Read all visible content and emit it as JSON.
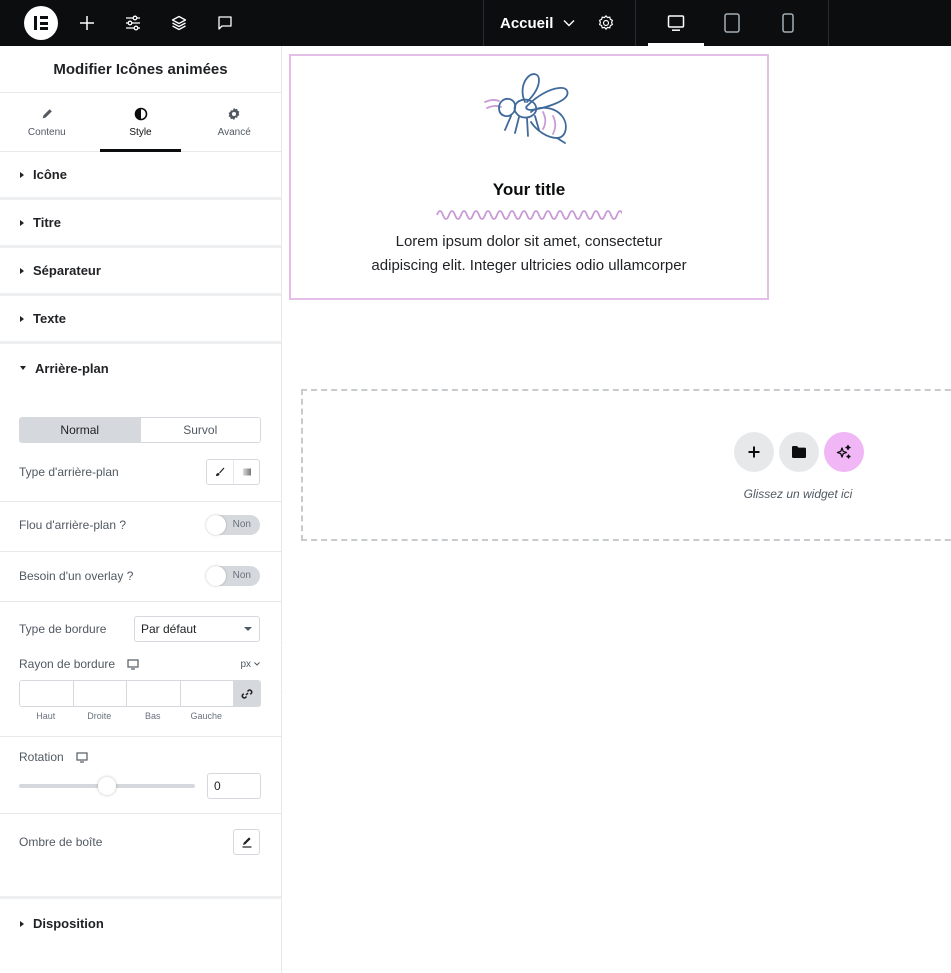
{
  "topbar": {
    "logo": "elementor-logo",
    "buttons": [
      "add-element",
      "site-settings",
      "structure",
      "notes"
    ],
    "page_name": "Accueil",
    "devices": [
      "desktop",
      "tablet",
      "mobile"
    ],
    "active_device": "desktop"
  },
  "panel": {
    "title": "Modifier Icônes animées",
    "tabs": [
      {
        "label": "Contenu",
        "icon": "pencil-icon"
      },
      {
        "label": "Style",
        "icon": "contrast-icon"
      },
      {
        "label": "Avancé",
        "icon": "gear-icon"
      }
    ],
    "active_tab": "Style",
    "sections": [
      {
        "label": "Icône",
        "open": false
      },
      {
        "label": "Titre",
        "open": false
      },
      {
        "label": "Séparateur",
        "open": false
      },
      {
        "label": "Texte",
        "open": false
      },
      {
        "label": "Arrière-plan",
        "open": true
      }
    ],
    "background": {
      "state_tabs": [
        "Normal",
        "Survol"
      ],
      "active_state": "Normal",
      "type_label": "Type d'arrière-plan",
      "blur_label": "Flou d'arrière-plan ?",
      "blur_value": "Non",
      "overlay_label": "Besoin d'un overlay ?",
      "overlay_value": "Non",
      "border_type_label": "Type de bordure",
      "border_type_value": "Par défaut",
      "radius_label": "Rayon de bordure",
      "radius_unit": "px",
      "radius_fields": [
        {
          "label": "Haut",
          "value": ""
        },
        {
          "label": "Droite",
          "value": ""
        },
        {
          "label": "Bas",
          "value": ""
        },
        {
          "label": "Gauche",
          "value": ""
        }
      ],
      "rotation_label": "Rotation",
      "rotation_value": "0",
      "rotation_slider_fraction": 0.5,
      "shadow_label": "Ombre de boîte"
    },
    "footer_section": {
      "label": "Disposition",
      "open": false
    }
  },
  "canvas": {
    "widget": {
      "icon": "wasp-icon",
      "title": "Your title",
      "text_line1": "Lorem ipsum dolor sit amet, consectetur",
      "text_line2": "adipiscing elit. Integer ultricies odio ullamcorper",
      "border_color": "#e4bfe8",
      "divider_color": "#c99bd6"
    },
    "dropzone": {
      "hint": "Glissez un widget ici",
      "buttons": [
        "add-section",
        "templates",
        "ai-assistant"
      ]
    }
  },
  "colors": {
    "topbar_bg": "#0c0d0e",
    "accent_ai": "#f0b6f6",
    "icon_stroke": "#3f6a9a",
    "icon_accent": "#c99bd6"
  }
}
